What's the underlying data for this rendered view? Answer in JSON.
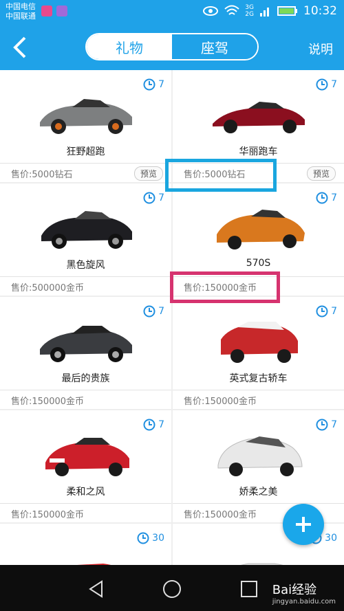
{
  "statusbar": {
    "carrier1": "中国电信",
    "carrier2": "中国联通",
    "net1": "3G",
    "net2": "2G",
    "time": "10:32"
  },
  "nav": {
    "tabs": [
      "礼物",
      "座驾"
    ],
    "active_tab": "座驾",
    "help": "说明"
  },
  "items": [
    {
      "name": "狂野超跑",
      "price": "售价:5000钻石",
      "timer": "7",
      "preview": "预览",
      "color": "#7d7f80"
    },
    {
      "name": "华丽跑车",
      "price": "售价:5000钻石",
      "timer": "7",
      "preview": "预览",
      "color": "#8b0f1f"
    },
    {
      "name": "黑色旋风",
      "price": "售价:500000金币",
      "timer": "7",
      "color": "#1e1e22"
    },
    {
      "name": "570S",
      "price": "售价:150000金币",
      "timer": "7",
      "color": "#d9781e"
    },
    {
      "name": "最后的贵族",
      "price": "售价:150000金币",
      "timer": "7",
      "color": "#3a3c40"
    },
    {
      "name": "英式复古轿车",
      "price": "售价:150000金币",
      "timer": "7",
      "color": "#c7282a"
    },
    {
      "name": "柔和之风",
      "price": "售价:150000金币",
      "timer": "7",
      "color": "#cc1f2a"
    },
    {
      "name": "娇柔之美",
      "price": "售价:150000金币",
      "timer": "7",
      "color": "#e8e8e8"
    },
    {
      "name": "",
      "price": "",
      "timer": "30",
      "color": "#d51f24"
    },
    {
      "name": "",
      "price": "",
      "timer": "30",
      "color": "#e0e0e0"
    }
  ],
  "watermark": {
    "text": "Bai经验",
    "sub": "jingyan.baidu.com"
  },
  "colors": {
    "accent": "#1fa2e8",
    "highlight_blue": "#1aa6df",
    "highlight_pink": "#d6336f"
  }
}
